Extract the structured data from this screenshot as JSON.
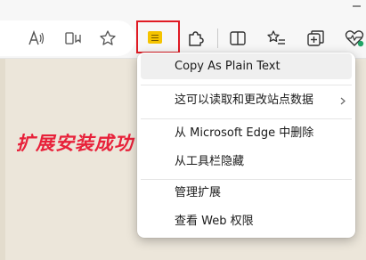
{
  "banner": {
    "text": "扩展安装成功"
  },
  "toolbar": {
    "icons": [
      "read-aloud-icon",
      "immersive-reader-icon",
      "favorite-star-icon",
      "extension-notes-icon",
      "extensions-puzzle-icon",
      "split-screen-icon",
      "favorites-list-icon",
      "collections-icon",
      "health-heart-icon"
    ]
  },
  "menu": {
    "items": [
      {
        "label": "Copy As Plain Text"
      },
      {
        "label": "这可以读取和更改站点数据"
      },
      {
        "label": "从 Microsoft Edge 中删除"
      },
      {
        "label": "从工具栏隐藏"
      },
      {
        "label": "管理扩展"
      },
      {
        "label": "查看 Web 权限"
      }
    ]
  },
  "colors": {
    "highlight_border": "#e01b24",
    "extension_icon": "#f5c400",
    "banner_text": "#e8213a",
    "page_background": "#ece6da",
    "status_dot": "#21a366"
  }
}
